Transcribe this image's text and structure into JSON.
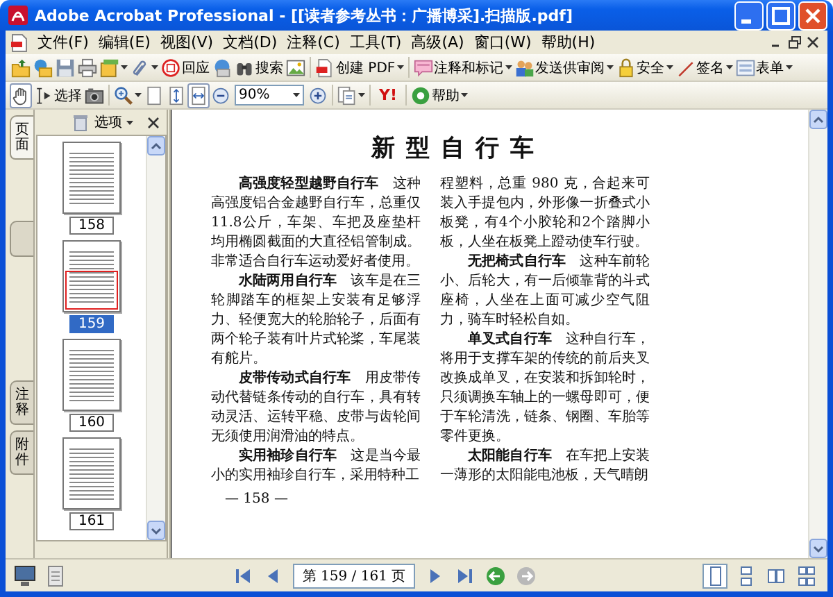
{
  "window": {
    "title": "Adobe Acrobat Professional - [[读者参考丛书：广播博采].扫描版.pdf]"
  },
  "menu": [
    "文件(F)",
    "编辑(E)",
    "视图(V)",
    "文档(D)",
    "注释(C)",
    "工具(T)",
    "高级(A)",
    "窗口(W)",
    "帮助(H)"
  ],
  "toolbar_main": [
    {
      "kind": "open"
    },
    {
      "kind": "organizer"
    },
    {
      "kind": "save"
    },
    {
      "kind": "print"
    },
    {
      "kind": "pages",
      "menu": true
    },
    {
      "kind": "attach",
      "menu": true
    },
    {
      "kind": "stamp",
      "label": "回应"
    },
    {
      "kind": "globe"
    },
    {
      "kind": "search",
      "label": "搜索"
    },
    {
      "kind": "picture"
    },
    {
      "kind": "separator"
    },
    {
      "kind": "create_pdf",
      "label": "创建 PDF",
      "menu": true
    },
    {
      "kind": "separator"
    },
    {
      "kind": "comment",
      "label": "注释和标记",
      "menu": true
    },
    {
      "kind": "review",
      "label": "发送供审阅",
      "menu": true
    },
    {
      "kind": "secure",
      "label": "安全",
      "menu": true
    },
    {
      "kind": "sign",
      "label": "签名",
      "menu": true
    },
    {
      "kind": "form",
      "label": "表单",
      "menu": true
    }
  ],
  "toolbar_view": [
    {
      "kind": "hand",
      "selected": true
    },
    {
      "kind": "select",
      "label": "选择",
      "selected": false
    },
    {
      "kind": "snapshot",
      "selected": false
    },
    {
      "kind": "separator"
    },
    {
      "kind": "zoom_in_tool",
      "menu": true
    },
    {
      "kind": "actual_size",
      "selected": false
    },
    {
      "kind": "fit_page",
      "selected": false
    },
    {
      "kind": "fit_width",
      "selected": true
    },
    {
      "kind": "zoom_out"
    },
    {
      "kind": "zoom_field",
      "value": "90%"
    },
    {
      "kind": "zoom_in"
    },
    {
      "kind": "separator"
    },
    {
      "kind": "page_menu",
      "menu": true
    },
    {
      "kind": "separator"
    },
    {
      "kind": "yahoo",
      "label": "Y!"
    },
    {
      "kind": "separator"
    },
    {
      "kind": "help",
      "label": "帮助",
      "menu": true
    }
  ],
  "sidebar": {
    "side_tabs": [
      {
        "label": "页面",
        "selected": true
      },
      {
        "selected": false
      },
      {
        "label": "注释",
        "selected": false
      },
      {
        "label": "附件",
        "selected": false
      }
    ],
    "options": "选项",
    "thumbnails": [
      {
        "label": "158",
        "selected": false
      },
      {
        "label": "159",
        "selected": true
      },
      {
        "label": "160",
        "selected": false
      },
      {
        "label": "161",
        "selected": false
      }
    ]
  },
  "document": {
    "title": "新型自行车",
    "columns": [
      {
        "paragraphs": [
          {
            "text": "**高强度轻型越野自行车**　这种高强度铝合金越野自行车，总重仅11.8公斤，车架、车把及座垫杆均用椭圆截面的大直径铝管制成。非常适合自行车运动爱好者使用。",
            "continued": false
          },
          {
            "text": "**水陆两用自行车**　该车是在三轮脚踏车的框架上安装有足够浮力、轻便宽大的轮胎轮子，后面有两个轮子装有叶片式轮桨，车尾装有舵片。",
            "continued": false
          },
          {
            "text": "**皮带传动式自行车**　用皮带传动代替链条传动的自行车，具有转动灵活、运转平稳、皮带与齿轮间无须使用润滑油的特点。",
            "continued": false
          },
          {
            "text": "**实用袖珍自行车**　这是当今最小的实用袖珍自行车，采用特种工",
            "continued": false
          }
        ]
      },
      {
        "paragraphs": [
          {
            "text": "程塑料，总重 980 克，合起来可装入手提包内，外形像一折叠式小板凳，有4个小胶轮和2个踏脚小板，人坐在板凳上蹬动使车行驶。",
            "continued": true
          },
          {
            "text": "**无把椅式自行车**　这种车前轮小、后轮大，有一后倾靠背的斗式座椅，人坐在上面可减少空气阻力，骑车时轻松自如。",
            "continued": false
          },
          {
            "text": "**单叉式自行车**　这种自行车，将用于支撑车架的传统的前后夹叉改换成单叉，在安装和拆卸轮时，只须调换车轴上的一螺母即可，便于车轮清洗，链条、钢圈、车胎等零件更换。",
            "continued": false
          },
          {
            "text": "**太阳能自行车**　在车把上安装一薄形的太阳能电池板，天气晴朗",
            "continued": false
          }
        ]
      }
    ],
    "page_number": "— 158 —"
  },
  "status": {
    "page_field": "第 159 / 161 页",
    "history": [
      {
        "kind": "back",
        "disabled": false
      },
      {
        "kind": "forward",
        "disabled": true
      }
    ],
    "layouts": [
      {
        "kind": "single",
        "selected": true
      },
      {
        "kind": "continuous",
        "selected": false
      },
      {
        "kind": "facing",
        "selected": false
      },
      {
        "kind": "continuous_facing",
        "selected": false
      }
    ]
  }
}
